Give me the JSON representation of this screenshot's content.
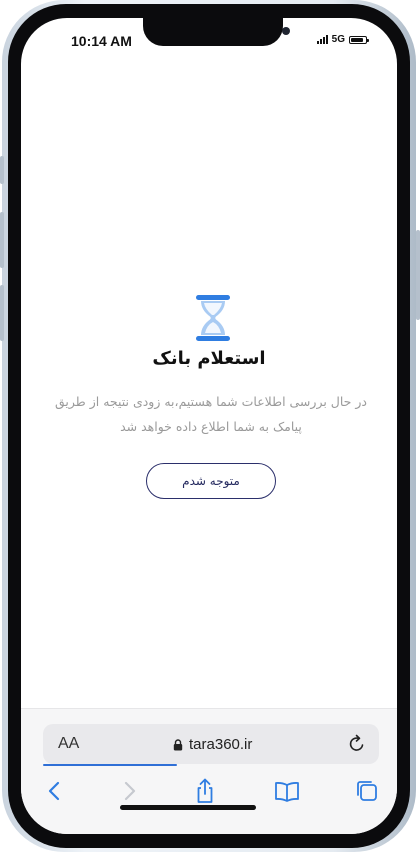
{
  "status_bar": {
    "time": "10:14 AM",
    "network": "5G",
    "battery_level": 0.85
  },
  "page": {
    "title": "استعلام بانک",
    "description": "در حال بررسی اطلاعات شما هستیم،به زودی نتیجه از طریق پیامک به شما اطلاع داده خواهد شد",
    "confirm_button": "متوجه شدم",
    "icon": "hourglass-icon",
    "accent_color": "#2f7de1"
  },
  "browser": {
    "text_size_label": "AA",
    "url": "tara360.ir",
    "load_progress": 0.4,
    "icons": [
      "lock-icon",
      "reload-icon",
      "back-icon",
      "forward-icon",
      "share-icon",
      "bookmarks-icon",
      "tabs-icon"
    ]
  }
}
